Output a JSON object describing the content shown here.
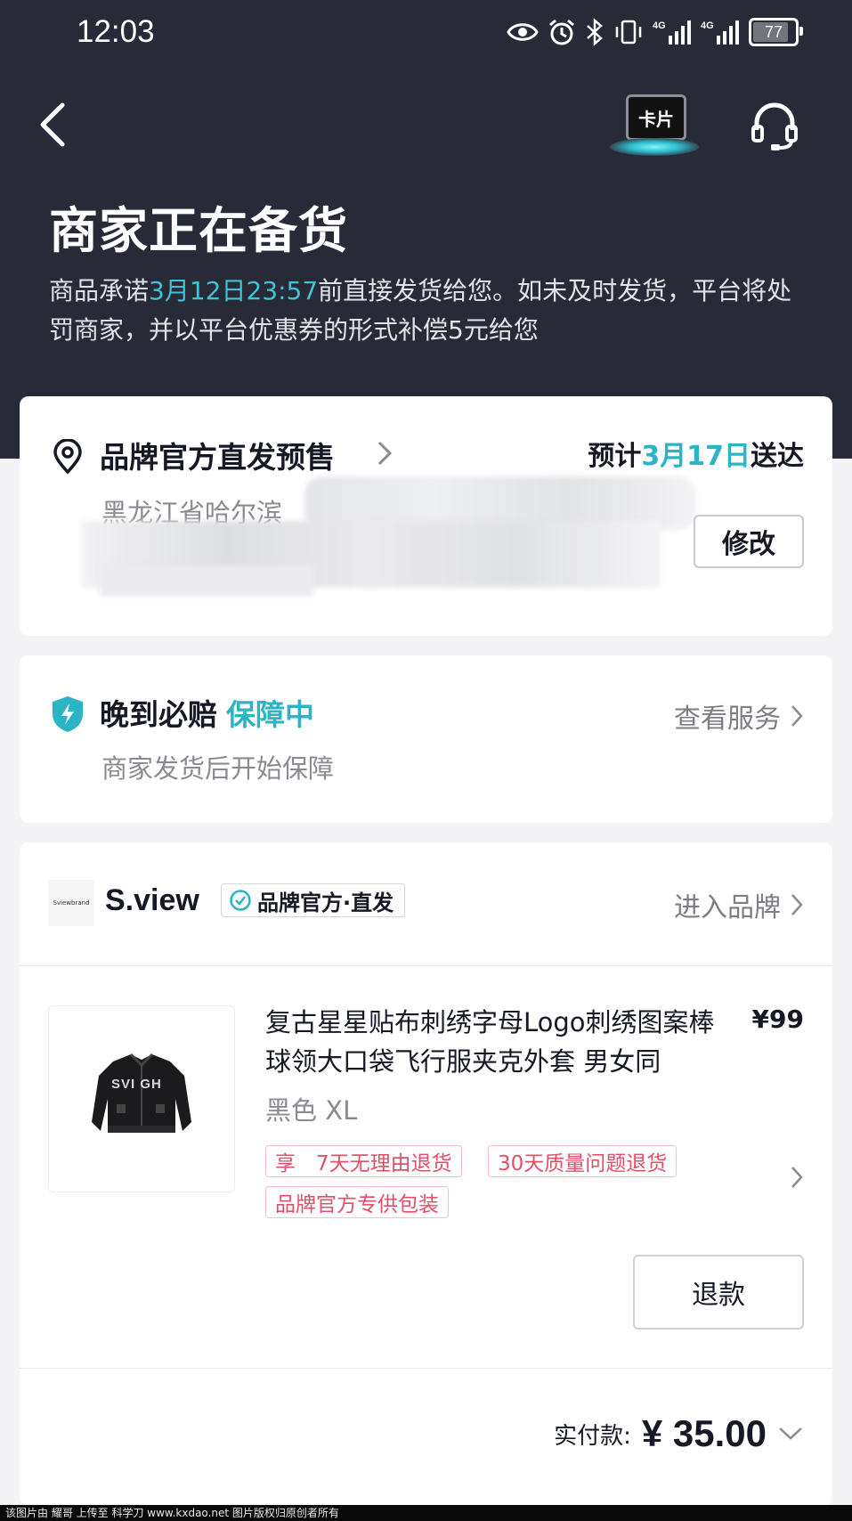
{
  "status_bar": {
    "time": "12:03",
    "battery": "77",
    "battery_level": 0.77,
    "icons": [
      "eye-icon",
      "alarm-icon",
      "bluetooth-icon",
      "vibrate-icon",
      "signal-4g-icon",
      "signal-4g-icon"
    ]
  },
  "nav": {
    "card_label": "卡片",
    "icons": [
      "back-icon",
      "headset-icon"
    ]
  },
  "header": {
    "title": "商家正在备货",
    "promise_before": "商品承诺",
    "promise_deadline": "3月12日23:57",
    "promise_after": "前直接发货给您。如未及时发货，平台将处罚商家，并以平台优惠券的形式补偿5元给您"
  },
  "address": {
    "title": "品牌官方直发预售",
    "eta_prefix": "预计",
    "eta_date": "3月17日",
    "eta_suffix": "送达",
    "line": "黑龙江省哈尔滨",
    "modify_label": "修改"
  },
  "guarantee": {
    "title": "晚到必赔",
    "status": "保障中",
    "subtitle": "商家发货后开始保障",
    "link": "查看服务"
  },
  "shop": {
    "logo_text": "Sviewbrand",
    "name": "S.view",
    "badge": "品牌官方·直发",
    "enter": "进入品牌"
  },
  "product": {
    "title": "复古星星贴布刺绣字母Logo刺绣图案棒球领大口袋飞行服夹克外套 男女同",
    "price": "¥99",
    "variant": "黑色 XL",
    "tags": [
      "享　7天无理由退货",
      "30天质量问题退货",
      "品牌官方专供包装"
    ],
    "refund_label": "退款"
  },
  "total": {
    "label": "实付款:",
    "amount": "¥ 35.00"
  },
  "watermark": "该图片由 耀哥 上传至 科学刀 www.kxdao.net 图片版权归原创者所有",
  "colors": {
    "header_bg": "#282a37",
    "accent": "#2ab4c6",
    "tag": "#e0506a"
  }
}
